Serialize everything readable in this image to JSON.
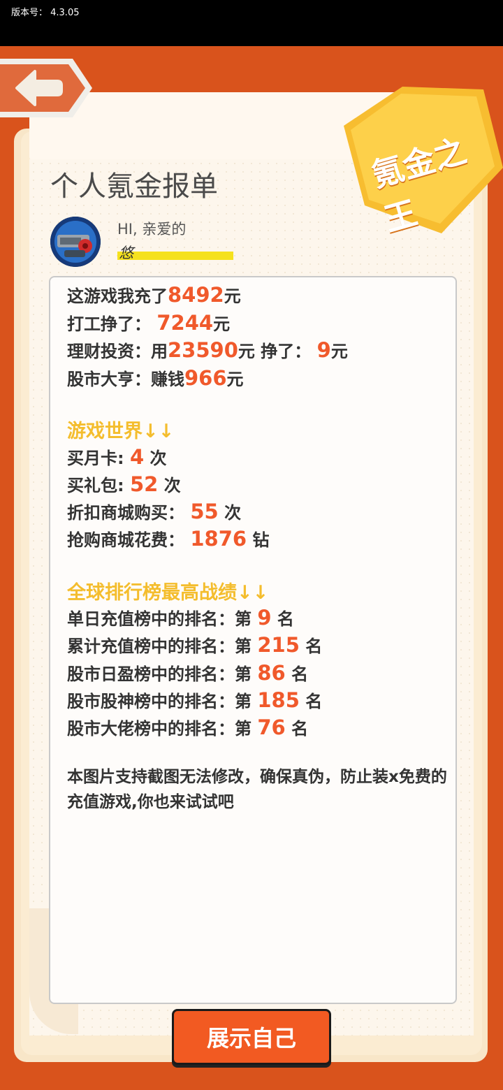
{
  "status_bar": {
    "version_label": "版本号： 4.3.05"
  },
  "header": {
    "badge_text": "氪金之王",
    "title": "个人氪金报单"
  },
  "user": {
    "greeting": "HI, 亲爱的",
    "name": "悠"
  },
  "stats": {
    "line1": {
      "prefix": "这游戏我充了",
      "value": "8492",
      "suffix": "元"
    },
    "line2": {
      "prefix": "打工挣了：",
      "value": "7244",
      "suffix": "元"
    },
    "line3": {
      "prefix": "理财投资：用",
      "value": "23590",
      "mid": "元 挣了：",
      "value2": "9",
      "suffix": "元"
    },
    "line4": {
      "prefix": "股市大亨：赚钱",
      "value": "966",
      "suffix": "元"
    }
  },
  "game_world": {
    "title": "游戏世界↓↓",
    "items": [
      {
        "prefix": "买月卡:",
        "value": "4",
        "suffix": "次"
      },
      {
        "prefix": "买礼包:",
        "value": "52",
        "suffix": "次"
      },
      {
        "prefix": "折扣商城购买：",
        "value": "55",
        "suffix": "次"
      },
      {
        "prefix": "抢购商城花费：",
        "value": "1876",
        "suffix": "钻"
      }
    ]
  },
  "rankings": {
    "title": "全球排行榜最高战绩↓↓",
    "items": [
      {
        "prefix": "单日充值榜中的排名：第",
        "value": "9",
        "suffix": "名"
      },
      {
        "prefix": "累计充值榜中的排名：第",
        "value": "215",
        "suffix": "名"
      },
      {
        "prefix": "股市日盈榜中的排名：第",
        "value": "86",
        "suffix": "名"
      },
      {
        "prefix": "股市股神榜中的排名：第",
        "value": "185",
        "suffix": "名"
      },
      {
        "prefix": "股市大佬榜中的排名：第",
        "value": "76",
        "suffix": "名"
      }
    ]
  },
  "note": "本图片支持截图无法修改，确保真伪，防止装x免费的充值游戏,你也来试试吧",
  "cta": {
    "label": "展示自己"
  },
  "colors": {
    "accent": "#f0592b",
    "section_title": "#f4bd2d",
    "background": "#d9531c",
    "button": "#f25a22"
  }
}
